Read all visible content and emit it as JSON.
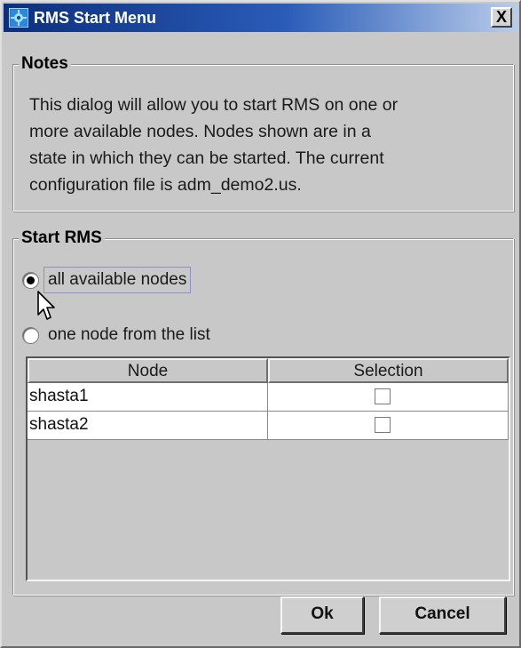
{
  "window": {
    "title": "RMS Start Menu",
    "close_label": "X",
    "app_icon": "rms-app-icon"
  },
  "notes": {
    "legend": "Notes",
    "lines": [
      "This dialog will allow you to start RMS on one or",
      "more available nodes. Nodes shown are in a",
      "state in which they can be started. The current",
      "configuration file is adm_demo2.us."
    ]
  },
  "start": {
    "legend": "Start RMS",
    "options": [
      {
        "label": "all available nodes",
        "checked": true
      },
      {
        "label": "one node from the list",
        "checked": false
      }
    ]
  },
  "table": {
    "headers": [
      "Node",
      "Selection"
    ],
    "rows": [
      {
        "node": "shasta1",
        "selected": false
      },
      {
        "node": "shasta2",
        "selected": false
      }
    ]
  },
  "buttons": {
    "ok": "Ok",
    "cancel": "Cancel"
  },
  "colors": {
    "titlebar_start": "#0c2f7c",
    "titlebar_end": "#b9cdea",
    "dialog_bg": "#c8c8c8"
  }
}
